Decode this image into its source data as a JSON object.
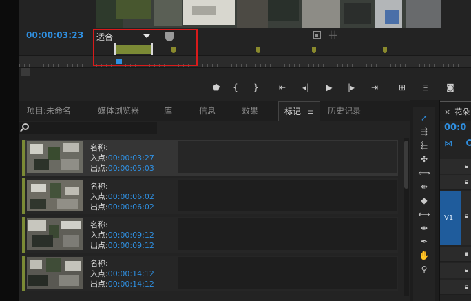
{
  "monitor": {
    "timecode": "00:00:03:23",
    "fit": "适合"
  },
  "panel": {
    "tabs": [
      {
        "label": "项目:未命名"
      },
      {
        "label": "媒体浏览器"
      },
      {
        "label": "库"
      },
      {
        "label": "信息"
      },
      {
        "label": "效果"
      },
      {
        "label": "标记",
        "active": true
      },
      {
        "label": "历史记录"
      }
    ],
    "search_placeholder": "",
    "marker_color": "#7b8a35",
    "markers": [
      {
        "name_label": "名称:",
        "in_label": "入点:",
        "in": "00:00:03:27",
        "out_label": "出点:",
        "out": "00:00:05:03",
        "selected": true
      },
      {
        "name_label": "名称:",
        "in_label": "入点:",
        "in": "00:00:06:02",
        "out_label": "出点:",
        "out": "00:00:06:02"
      },
      {
        "name_label": "名称:",
        "in_label": "入点:",
        "in": "00:00:09:12",
        "out_label": "出点:",
        "out": "00:00:09:12"
      },
      {
        "name_label": "名称:",
        "in_label": "入点:",
        "in": "00:00:14:12",
        "out_label": "出点:",
        "out": "00:00:14:12"
      }
    ]
  },
  "timeline": {
    "tab_title": "花朵",
    "timecode": "00:0",
    "track_label": "V1"
  },
  "accent_blue": "#2f8fe0",
  "highlight_red": "#d81b1b"
}
